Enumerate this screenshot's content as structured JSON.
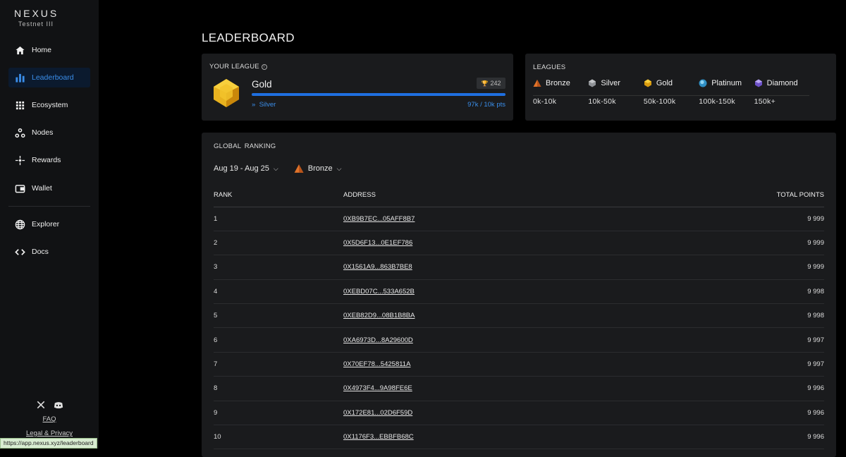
{
  "app": {
    "name": "NEXUS",
    "subtitle": "Testnet III"
  },
  "sidebar": {
    "items": [
      {
        "label": "Home",
        "icon": "home-icon"
      },
      {
        "label": "Leaderboard",
        "icon": "bar-chart-icon",
        "active": true
      },
      {
        "label": "Ecosystem",
        "icon": "grid-icon"
      },
      {
        "label": "Nodes",
        "icon": "nodes-icon"
      },
      {
        "label": "Rewards",
        "icon": "sparkle-icon"
      },
      {
        "label": "Wallet",
        "icon": "wallet-icon"
      },
      {
        "label": "Explorer",
        "icon": "globe-icon"
      },
      {
        "label": "Docs",
        "icon": "code-icon"
      }
    ],
    "faq": "FAQ",
    "legal": "Legal & Privacy",
    "status_url": "https://app.nexus.xyz/leaderboard"
  },
  "page": {
    "title": "LEADERBOARD"
  },
  "your_league": {
    "label": "YOUR LEAGUE",
    "name": "Gold",
    "rank_badge": "242",
    "next_league": "Silver",
    "points": "97k / 10k pts",
    "progress": 1.0
  },
  "leagues": {
    "label": "LEAGUES",
    "items": [
      {
        "name": "Bronze",
        "range": "0k-10k",
        "color": "#e0732a"
      },
      {
        "name": "Silver",
        "range": "10k-50k",
        "color": "#8f9296"
      },
      {
        "name": "Gold",
        "range": "50k-100k",
        "color": "#e8b51e"
      },
      {
        "name": "Platinum",
        "range": "100k-150k",
        "color": "#4aa8d8"
      },
      {
        "name": "Diamond",
        "range": "150k+",
        "color": "#8a6ee0"
      }
    ]
  },
  "ranking": {
    "label": "GLOBAL RANKING",
    "date_filter": "Aug 19 - Aug 25",
    "league_filter": "Bronze",
    "columns": {
      "rank": "RANK",
      "address": "ADDRESS",
      "points": "TOTAL POINTS"
    },
    "rows": [
      {
        "rank": "1",
        "address": "0XB9B7EC...05AFF8B7",
        "points": "9 999"
      },
      {
        "rank": "2",
        "address": "0X5D6F13...0E1EF786",
        "points": "9 999"
      },
      {
        "rank": "3",
        "address": "0X1561A9...863B7BE8",
        "points": "9 999"
      },
      {
        "rank": "4",
        "address": "0XEBD07C...533A652B",
        "points": "9 998"
      },
      {
        "rank": "5",
        "address": "0XEB82D9...08B1B8BA",
        "points": "9 998"
      },
      {
        "rank": "6",
        "address": "0XA6973D...8A29600D",
        "points": "9 997"
      },
      {
        "rank": "7",
        "address": "0X70EF78...5425811A",
        "points": "9 997"
      },
      {
        "rank": "8",
        "address": "0X4973F4...9A98FE6E",
        "points": "9 996"
      },
      {
        "rank": "9",
        "address": "0X172E81...02D6F59D",
        "points": "9 996"
      },
      {
        "rank": "10",
        "address": "0X1176F3...EBBFB68C",
        "points": "9 996"
      }
    ]
  }
}
